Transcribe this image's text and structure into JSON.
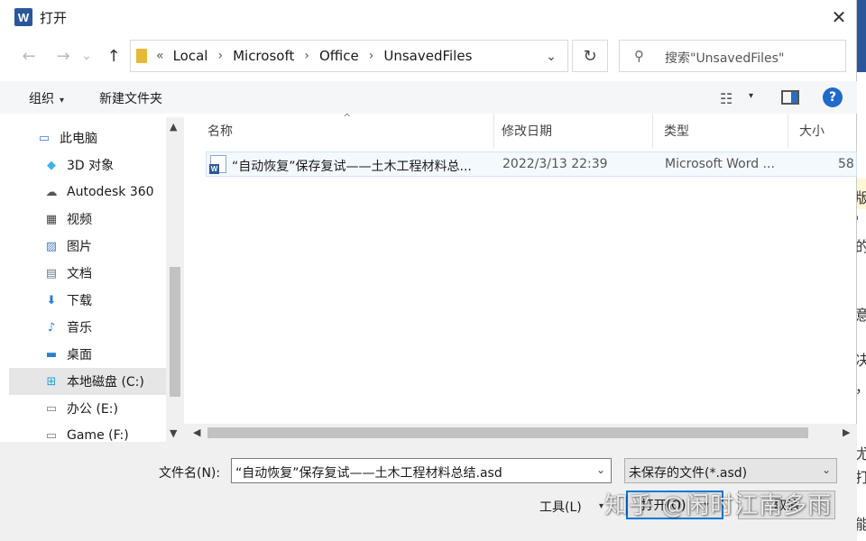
{
  "window": {
    "title": "打开",
    "app_icon": "word-icon",
    "close_glyph": "✕"
  },
  "nav": {
    "back_glyph": "←",
    "forward_glyph": "→",
    "recent_glyph": "⌄",
    "up_glyph": "↑"
  },
  "address": {
    "overflow": "«",
    "crumbs": [
      "Local",
      "Microsoft",
      "Office",
      "UnsavedFiles"
    ],
    "separator": "›",
    "dropdown_glyph": "⌄"
  },
  "refresh_glyph": "↻",
  "search": {
    "icon_glyph": "⚲",
    "placeholder": "搜索\"UnsavedFiles\""
  },
  "toolbar": {
    "organize_label": "组织",
    "new_folder_label": "新建文件夹",
    "caret": "▾",
    "view_glyph": "☷",
    "help_glyph": "?"
  },
  "sidebar": {
    "items": [
      {
        "label": "此电脑",
        "icon": "computer-icon",
        "glyph": "💻",
        "color": "#3a7bd5"
      },
      {
        "label": "3D 对象",
        "icon": "3d-objects-icon",
        "glyph": "◆",
        "color": "#3bb3e6"
      },
      {
        "label": "Autodesk 360",
        "icon": "cloud-icon",
        "glyph": "☁",
        "color": "#555555"
      },
      {
        "label": "视频",
        "icon": "video-icon",
        "glyph": "▦",
        "color": "#444444"
      },
      {
        "label": "图片",
        "icon": "pictures-icon",
        "glyph": "▨",
        "color": "#4a7fb5"
      },
      {
        "label": "文档",
        "icon": "documents-icon",
        "glyph": "▤",
        "color": "#6a7a8a"
      },
      {
        "label": "下载",
        "icon": "download-icon",
        "glyph": "⬇",
        "color": "#2a7fd4"
      },
      {
        "label": "音乐",
        "icon": "music-icon",
        "glyph": "♪",
        "color": "#2a7fd4"
      },
      {
        "label": "桌面",
        "icon": "desktop-icon",
        "glyph": "▬",
        "color": "#2a7fd4"
      },
      {
        "label": "本地磁盘 (C:)",
        "icon": "local-disk-icon",
        "glyph": "⊞",
        "color": "#2a9fd8"
      },
      {
        "label": "办公 (E:)",
        "icon": "drive-icon",
        "glyph": "▭",
        "color": "#777777"
      },
      {
        "label": "Game (F:)",
        "icon": "drive-icon",
        "glyph": "▭",
        "color": "#777777"
      }
    ],
    "selected_index": 9,
    "scroll_up": "▲",
    "scroll_down": "▼"
  },
  "list": {
    "columns": [
      "名称",
      "修改日期",
      "类型",
      "大小"
    ],
    "sort_glyph": "^",
    "rows": [
      {
        "name": "“自动恢复”保存复试——土木工程材料总...",
        "date": "2022/3/13 22:39",
        "type": "Microsoft Word ...",
        "size": "58"
      }
    ],
    "scroll_left": "◀",
    "scroll_right": "▶"
  },
  "bottom": {
    "filename_label": "文件名(N):",
    "filename_value": "“自动恢复”保存复试——土木工程材料总结.asd",
    "filter_value": "未保存的文件(*.asd)",
    "dropdown_glyph": "⌄",
    "tools_label": "工具(L)",
    "open_label": "打开(O)",
    "cancel_label": "取消",
    "caret": "▾"
  },
  "watermark": "知乎 @闲时江南多雨",
  "background_chars": [
    "版",
    "'",
    "的",
    "意",
    "决",
    "，",
    "尤",
    "打",
    "能"
  ]
}
